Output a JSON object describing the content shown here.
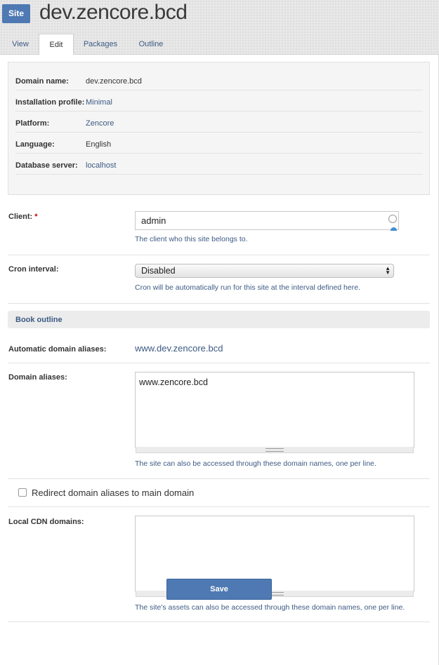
{
  "header": {
    "badge": "Site",
    "title": "dev.zencore.bcd",
    "tabs": [
      {
        "label": "View",
        "active": false
      },
      {
        "label": "Edit",
        "active": true
      },
      {
        "label": "Packages",
        "active": false
      },
      {
        "label": "Outline",
        "active": false
      }
    ]
  },
  "info": {
    "rows": [
      {
        "label": "Domain name:",
        "value": "dev.zencore.bcd"
      },
      {
        "label": "Installation profile:",
        "value": "Minimal"
      },
      {
        "label": "Platform:",
        "value": "Zencore"
      },
      {
        "label": "Language:",
        "value": "English"
      },
      {
        "label": "Database server:",
        "value": "localhost"
      }
    ]
  },
  "form": {
    "client": {
      "label": "Client:",
      "required_mark": "*",
      "value": "admin",
      "description": "The client who this site belongs to."
    },
    "cron": {
      "label": "Cron interval:",
      "selected": "Disabled",
      "description": "Cron will be automatically run for this site at the interval defined here."
    },
    "book_outline": "Book outline",
    "auto_aliases": {
      "label": "Automatic domain aliases:",
      "value": "www.dev.zencore.bcd"
    },
    "domain_aliases": {
      "label": "Domain aliases:",
      "value": "www.zencore.bcd",
      "description": "The site can also be accessed through these domain names, one per line."
    },
    "redirect": {
      "label": "Redirect domain aliases to main domain",
      "checked": false
    },
    "cdn": {
      "label": "Local CDN domains:",
      "value": "",
      "description": "The site's assets can also be accessed through these domain names, one per line."
    },
    "save_label": "Save"
  },
  "colors": {
    "accent": "#4e79b3",
    "link": "#3c5a83"
  }
}
